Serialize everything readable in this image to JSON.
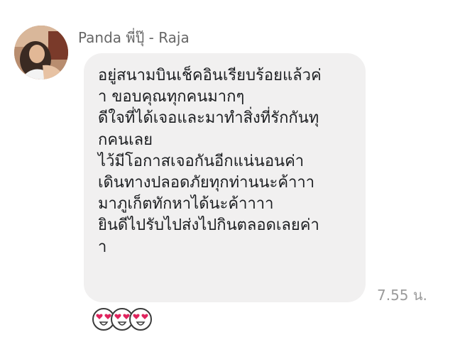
{
  "message": {
    "sender": "Panda พี่ปุ๊ - Raja",
    "lines": [
      "อยู่สนามบินเช็คอินเรียบร้อยแล้วค่",
      "า ขอบคุณทุกคนมากๆ",
      "ดีใจที่ได้เจอและมาทำสิ่งที่รักกันทุ",
      "กคนเลย",
      "ไว้มีโอกาสเจอกันอีกแน่นอนค่า",
      "เดินทางปลอดภัยทุกท่านนะค้าาา",
      "มาภูเก็ตทักหาได้นะค้าาาา",
      "ยินดีไปรับไปส่งไปกินตลอดเลยค่า",
      "า"
    ],
    "time": "7.55 น."
  },
  "reactions": [
    {
      "icon": "heart-eyes-emoji-icon"
    },
    {
      "icon": "heart-eyes-emoji-icon"
    },
    {
      "icon": "heart-eyes-emoji-icon"
    }
  ],
  "colors": {
    "bubble": "#f1f0f0",
    "text": "#1c1e21",
    "sender": "#666666",
    "time": "#9b9b9b",
    "heart": "#e0245e"
  }
}
